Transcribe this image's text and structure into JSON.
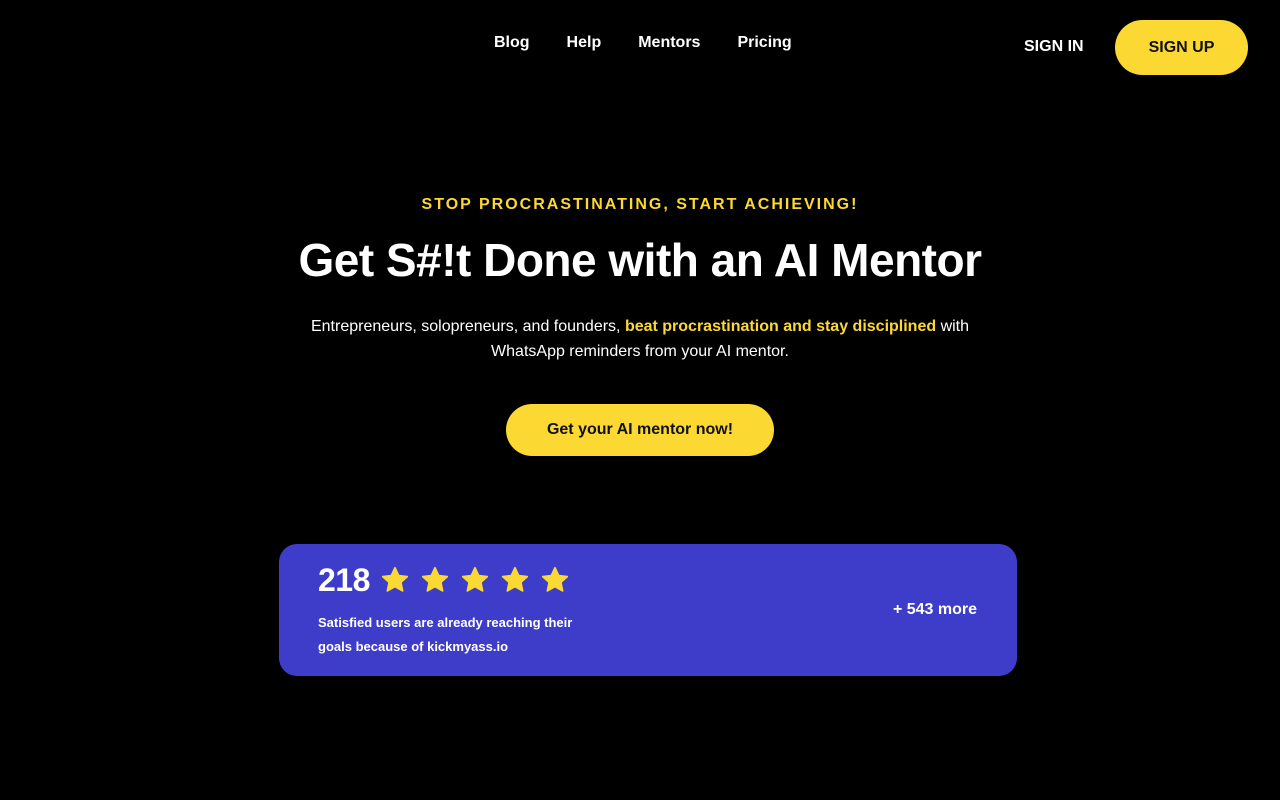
{
  "nav": {
    "links": [
      "Blog",
      "Help",
      "Mentors",
      "Pricing"
    ],
    "sign_in": "SIGN IN",
    "sign_up": "SIGN UP"
  },
  "hero": {
    "eyebrow": "STOP PROCRASTINATING, START ACHIEVING!",
    "headline": "Get S#!t Done with an AI Mentor",
    "subtext_before": "Entrepreneurs, solopreneurs, and founders, ",
    "subtext_highlight": "beat procrastination and stay disciplined",
    "subtext_after": " with WhatsApp reminders from your AI mentor.",
    "cta": "Get your AI mentor now!"
  },
  "social_proof": {
    "count": "218",
    "rating": 5,
    "description": "Satisfied users are already reaching their goals because of kickmyass.io",
    "more": "+ 543 more"
  },
  "colors": {
    "background": "#000000",
    "accent_yellow": "#fcd833",
    "card_blue": "#3d3dc9",
    "text": "#ffffff"
  },
  "icons": {
    "star": "star-icon"
  }
}
